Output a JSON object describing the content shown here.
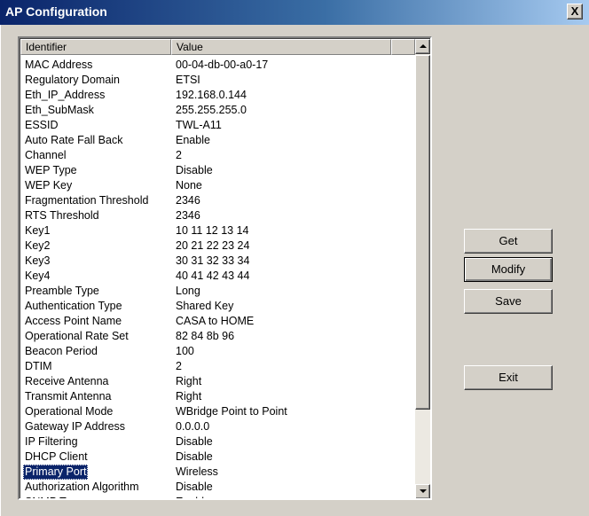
{
  "window": {
    "title": "AP Configuration",
    "close_label": "X"
  },
  "list": {
    "columns": [
      "Identifier",
      "Value"
    ],
    "selected_row": "Primary Port",
    "rows": [
      {
        "id": "MAC Address",
        "value": "00-04-db-00-a0-17"
      },
      {
        "id": "Regulatory Domain",
        "value": "ETSI"
      },
      {
        "id": "Eth_IP_Address",
        "value": "192.168.0.144"
      },
      {
        "id": "Eth_SubMask",
        "value": "255.255.255.0"
      },
      {
        "id": "ESSID",
        "value": "TWL-A11"
      },
      {
        "id": "Auto Rate Fall Back",
        "value": "Enable"
      },
      {
        "id": "Channel",
        "value": "2"
      },
      {
        "id": "WEP Type",
        "value": "Disable"
      },
      {
        "id": "WEP Key",
        "value": "None"
      },
      {
        "id": "Fragmentation Threshold",
        "value": "2346"
      },
      {
        "id": "RTS Threshold",
        "value": "2346"
      },
      {
        "id": "Key1",
        "value": "10 11 12 13 14"
      },
      {
        "id": "Key2",
        "value": "20 21 22 23 24"
      },
      {
        "id": "Key3",
        "value": "30 31 32 33 34"
      },
      {
        "id": "Key4",
        "value": "40 41 42 43 44"
      },
      {
        "id": "Preamble Type",
        "value": "Long"
      },
      {
        "id": "Authentication Type",
        "value": "Shared Key"
      },
      {
        "id": "Access Point Name",
        "value": "CASA to HOME"
      },
      {
        "id": "Operational Rate Set",
        "value": "82 84 8b 96"
      },
      {
        "id": "Beacon Period",
        "value": "100"
      },
      {
        "id": "DTIM",
        "value": "2"
      },
      {
        "id": "Receive Antenna",
        "value": "Right"
      },
      {
        "id": "Transmit Antenna",
        "value": "Right"
      },
      {
        "id": "Operational Mode",
        "value": "WBridge Point to Point"
      },
      {
        "id": "Gateway IP Address",
        "value": "0.0.0.0"
      },
      {
        "id": "IP Filtering",
        "value": "Disable"
      },
      {
        "id": "DHCP Client",
        "value": "Disable"
      },
      {
        "id": "Primary Port",
        "value": "Wireless"
      },
      {
        "id": "Authorization Algorithm",
        "value": "Disable"
      },
      {
        "id": "SNMP Traps",
        "value": "Enable"
      }
    ]
  },
  "buttons": {
    "get": "Get",
    "modify": "Modify",
    "save": "Save",
    "exit": "Exit"
  },
  "colors": {
    "title_bar": "#0a246a",
    "selection": "#0a246a",
    "face": "#d4d0c8"
  }
}
